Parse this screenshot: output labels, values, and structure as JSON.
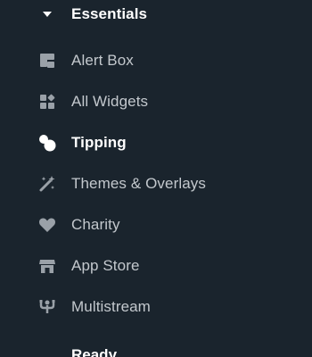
{
  "section": {
    "title": "Essentials",
    "expanded": true
  },
  "items": [
    {
      "label": "Alert Box",
      "icon": "alert-box-icon",
      "active": false
    },
    {
      "label": "All Widgets",
      "icon": "widgets-grid-icon",
      "active": false
    },
    {
      "label": "Tipping",
      "icon": "tipping-coins-icon",
      "active": true
    },
    {
      "label": "Themes & Overlays",
      "icon": "magic-wand-icon",
      "active": false
    },
    {
      "label": "Charity",
      "icon": "heart-icon",
      "active": false
    },
    {
      "label": "App Store",
      "icon": "store-icon",
      "active": false
    },
    {
      "label": "Multistream",
      "icon": "multistream-icon",
      "active": false
    }
  ],
  "next_section": {
    "title": "Ready"
  },
  "colors": {
    "background": "#1a242d",
    "icon": "#9aa1a8",
    "label": "#c3c8cd",
    "active": "#ffffff"
  }
}
